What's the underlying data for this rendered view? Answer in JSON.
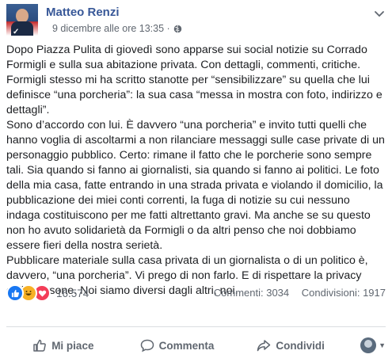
{
  "post": {
    "author": "Matteo Renzi",
    "timestamp": "9 dicembre alle ore 13:35 ·",
    "privacy_icon": "globe-icon",
    "paragraphs": [
      "Dopo Piazza Pulita di giovedì sono apparse sui social notizie su Corrado Formigli e sulla sua abitazione privata. Con dettagli, commenti, critiche. Formigli stesso mi ha scritto stanotte per “sensibilizzare” su quella che lui definisce “una porcheria”: la sua casa “messa in mostra con foto, indirizzo e dettagli”.",
      "Sono d’accordo con lui. È davvero “una porcheria” e invito tutti quelli che hanno voglia di ascoltarmi a non rilanciare messaggi sulle case private di un personaggio pubblico. Certo: rimane il fatto che le porcherie sono sempre tali. Sia quando si fanno ai giornalisti, sia quando si fanno ai politici. Le foto della mia casa, fatte entrando in una strada privata e violando il domicilio, la pubblicazione dei miei conti correnti, la fuga di notizie su cui nessuno indaga costituiscono per me fatti altrettanto gravi. Ma anche se su questo non ho avuto solidarietà da Formigli o da altri penso che noi dobbiamo essere fieri della nostra serietà.",
      "Pubblicare materiale sulla casa privata di un giornalista o di un politico è, davvero, “una porcheria”. Vi prego di non farlo. E di rispettare la privacy delle persone. Noi siamo diversi dagli altri, noi."
    ]
  },
  "stats": {
    "reaction_count": "16.574",
    "comments": "Commenti: 3034",
    "shares": "Condivisioni: 1917"
  },
  "actions": {
    "like": "Mi piace",
    "comment": "Commenta",
    "share": "Condividi"
  },
  "colors": {
    "author": "#385898",
    "muted": "#606770",
    "like_blue": "#1877f2"
  }
}
